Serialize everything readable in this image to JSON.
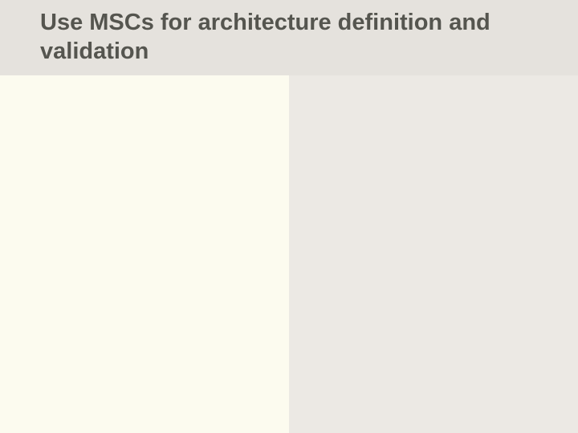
{
  "slide": {
    "title": "Use MSCs for architecture definition and validation"
  }
}
